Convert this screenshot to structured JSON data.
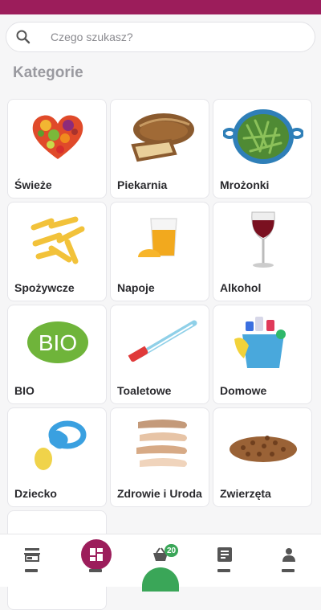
{
  "search": {
    "placeholder": "Czego szukasz?"
  },
  "section_title": "Kategorie",
  "categories": [
    {
      "label": "Świeże",
      "icon": "fruit-heart-icon"
    },
    {
      "label": "Piekarnia",
      "icon": "bread-icon"
    },
    {
      "label": "Mrożonki",
      "icon": "green-beans-bowl-icon"
    },
    {
      "label": "Spożywcze",
      "icon": "pasta-icon"
    },
    {
      "label": "Napoje",
      "icon": "juice-glass-icon"
    },
    {
      "label": "Alkohol",
      "icon": "wine-glass-icon"
    },
    {
      "label": "BIO",
      "icon": "bio-leaf-icon"
    },
    {
      "label": "Toaletowe",
      "icon": "toothbrush-icon"
    },
    {
      "label": "Domowe",
      "icon": "cleaning-bucket-icon"
    },
    {
      "label": "Dziecko",
      "icon": "pacifier-icon"
    },
    {
      "label": "Zdrowie i Uroda",
      "icon": "makeup-swatches-icon"
    },
    {
      "label": "Zwierzęta",
      "icon": "pet-food-icon"
    },
    {
      "label": "",
      "icon": "apple-icon"
    }
  ],
  "bio_text": "BIO",
  "nav": {
    "items": [
      {
        "icon": "store-icon"
      },
      {
        "icon": "home-grid-icon",
        "active": true
      },
      {
        "icon": "basket-icon"
      },
      {
        "icon": "orders-list-icon"
      },
      {
        "icon": "account-icon"
      }
    ],
    "cart_count": "20"
  },
  "colors": {
    "brand": "#9c1d5b",
    "badge": "#3aa658"
  }
}
